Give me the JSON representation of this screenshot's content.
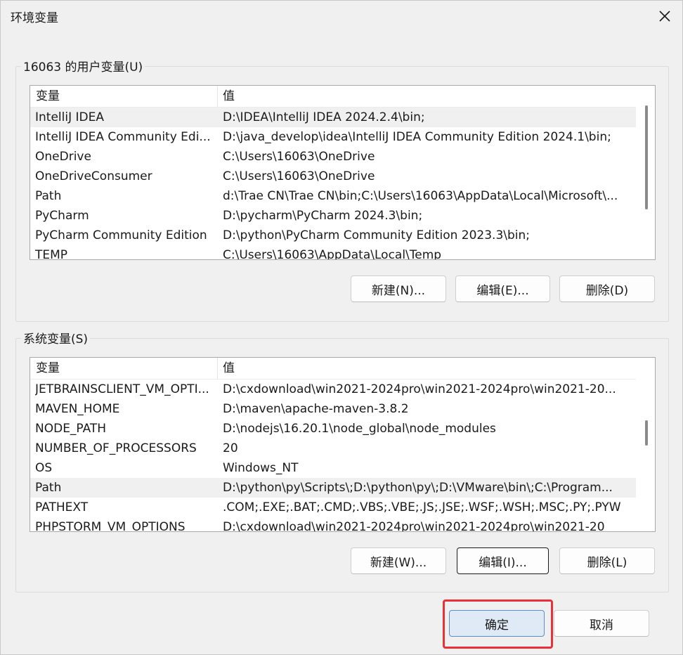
{
  "window": {
    "title": "环境变量"
  },
  "icons": {
    "close": "close-icon"
  },
  "user_vars": {
    "group_label": "16063 的用户变量(U)",
    "header": {
      "variable": "变量",
      "value": "值"
    },
    "rows": [
      {
        "name": "IntelliJ IDEA",
        "value": "D:\\IDEA\\IntelliJ IDEA 2024.2.4\\bin;"
      },
      {
        "name": "IntelliJ IDEA Community Edi...",
        "value": "D:\\java_develop\\idea\\IntelliJ IDEA Community Edition 2024.1\\bin;"
      },
      {
        "name": "OneDrive",
        "value": "C:\\Users\\16063\\OneDrive"
      },
      {
        "name": "OneDriveConsumer",
        "value": "C:\\Users\\16063\\OneDrive"
      },
      {
        "name": "Path",
        "value": "d:\\Trae CN\\Trae CN\\bin;C:\\Users\\16063\\AppData\\Local\\Microsoft\\..."
      },
      {
        "name": "PyCharm",
        "value": "D:\\pycharm\\PyCharm 2024.3\\bin;"
      },
      {
        "name": "PyCharm Community Edition",
        "value": "D:\\python\\PyCharm Community Edition 2023.3\\bin;"
      },
      {
        "name": "TEMP",
        "value": "C:\\Users\\16063\\AppData\\Local\\Temp"
      }
    ],
    "buttons": {
      "new": "新建(N)...",
      "edit": "编辑(E)...",
      "delete": "删除(D)"
    }
  },
  "system_vars": {
    "group_label": "系统变量(S)",
    "header": {
      "variable": "变量",
      "value": "值"
    },
    "rows": [
      {
        "name": "JETBRAINSCLIENT_VM_OPTI...",
        "value": "D:\\cxdownload\\win2021-2024pro\\win2021-2024pro\\win2021-20..."
      },
      {
        "name": "MAVEN_HOME",
        "value": "D:\\maven\\apache-maven-3.8.2"
      },
      {
        "name": "NODE_PATH",
        "value": "D:\\nodejs\\16.20.1\\node_global\\node_modules"
      },
      {
        "name": "NUMBER_OF_PROCESSORS",
        "value": "20"
      },
      {
        "name": "OS",
        "value": "Windows_NT"
      },
      {
        "name": "Path",
        "value": "D:\\python\\py\\Scripts\\;D:\\python\\py\\;D:\\VMware\\bin\\;C:\\Program..."
      },
      {
        "name": "PATHEXT",
        "value": ".COM;.EXE;.BAT;.CMD;.VBS;.VBE;.JS;.JSE;.WSF;.WSH;.MSC;.PY;.PYW"
      },
      {
        "name": "PHPSTORM_VM_OPTIONS",
        "value": "D:\\cxdownload\\win2021-2024pro\\win2021-2024pro\\win2021-20"
      }
    ],
    "buttons": {
      "new": "新建(W)...",
      "edit": "编辑(I)...",
      "delete": "删除(L)"
    }
  },
  "footer": {
    "ok": "确定",
    "cancel": "取消"
  },
  "colors": {
    "highlight": "#e8323a",
    "primary_button": "#dfeaf6"
  }
}
